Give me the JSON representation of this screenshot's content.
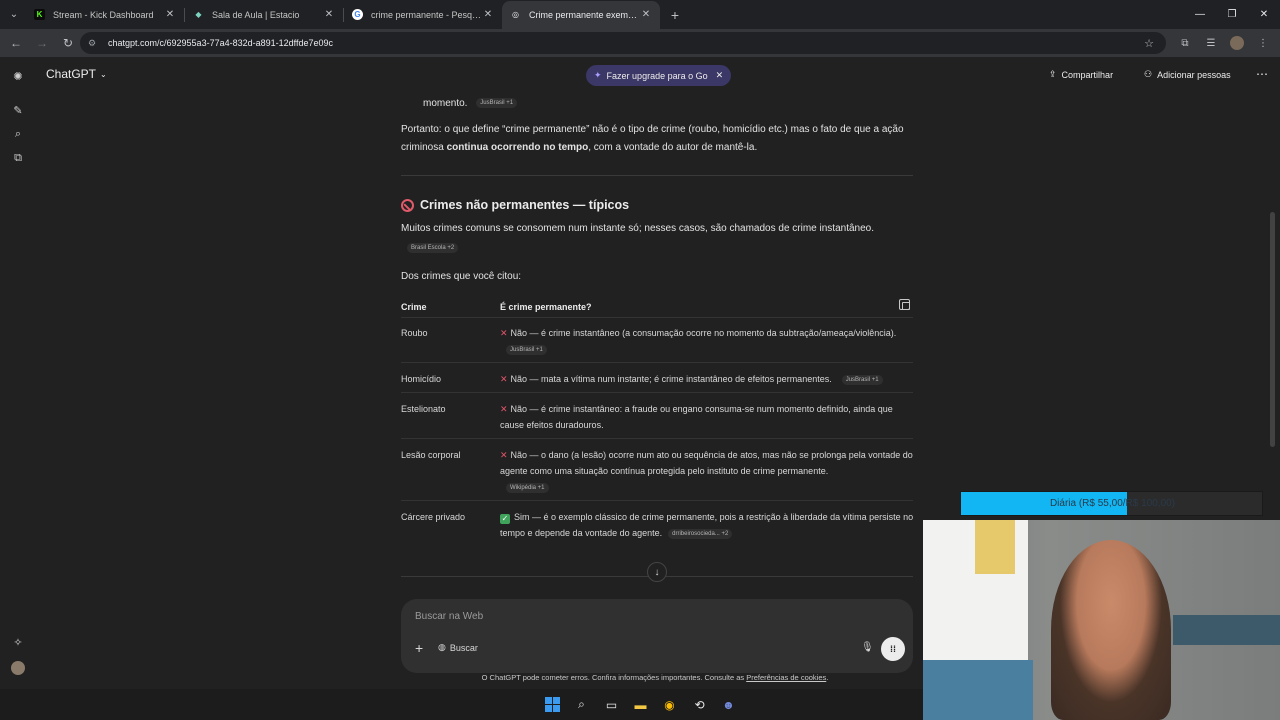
{
  "browser": {
    "tabs": [
      {
        "title": "Stream - Kick Dashboard",
        "favicon_color": "#53fc18",
        "favicon_glyph": "K"
      },
      {
        "title": "Sala de Aula | Estacio",
        "favicon_color": "#7dd3c0",
        "favicon_glyph": "◆"
      },
      {
        "title": "crime permanente - Pesquisa G",
        "favicon_color": "#e8eaed",
        "favicon_glyph": "G"
      },
      {
        "title": "Crime permanente exemplos",
        "favicon_color": "#e8eaed",
        "favicon_glyph": "◎",
        "active": true
      }
    ],
    "url": "chatgpt.com/c/692955a3-77a4-832d-a891-12dffde7e09c"
  },
  "app": {
    "brand": "ChatGPT",
    "upgrade_label": "Fazer upgrade para o Go",
    "share_label": "Compartilhar",
    "add_people_label": "Adicionar pessoas"
  },
  "conversation": {
    "prev_item_text": "momento.",
    "prev_item_chip": "JusBrasil +1",
    "para1_a": "Portanto: o que define “crime permanente” não é o tipo de crime (roubo, homicídio etc.) mas o fato de que a ação criminosa ",
    "para1_bold": "continua ocorrendo no tempo",
    "para1_b": ", com a vontade do autor de mantê-la.",
    "heading": "Crimes não permanentes — típicos",
    "para2": "Muitos crimes comuns se consomem num instante só; nesses casos, são chamados de crime instantâneo.",
    "para2_chip": "Brasil Escola +2",
    "para3": "Dos crimes que você citou:",
    "table": {
      "headers": [
        "Crime",
        "É crime permanente?"
      ],
      "rows": [
        {
          "crime": "Roubo",
          "mark": "✕",
          "answer": "Não — é crime instantâneo (a consumação ocorre no momento da subtração/ameaça/violência).",
          "chip": "JusBrasil +1"
        },
        {
          "crime": "Homicídio",
          "mark": "✕",
          "answer": "Não — mata a vítima num instante; é crime instantâneo de efeitos permanentes.",
          "chip": "JusBrasil +1"
        },
        {
          "crime": "Estelionato",
          "mark": "✕",
          "answer": "Não — é crime instantâneo: a fraude ou engano consuma-se num momento definido, ainda que cause efeitos duradouros.",
          "chip": ""
        },
        {
          "crime": "Lesão corporal",
          "mark": "✕",
          "answer": "Não — o dano (a lesão) ocorre num ato ou sequência de atos, mas não se prolonga pela vontade do agente como uma situação contínua protegida pelo instituto de crime permanente.",
          "chip": "Wikipédia +1"
        },
        {
          "crime": "Cárcere privado",
          "mark": "✓",
          "answer": "Sim — é o exemplo clássico de crime permanente, pois a restrição à liberdade da vítima persiste no tempo e depende da vontade do agente.",
          "chip": "drribeirosocieda... +2"
        }
      ]
    }
  },
  "composer": {
    "placeholder": "Buscar na Web",
    "search_tool_label": "Buscar"
  },
  "disclaimer": {
    "text": "O ChatGPT pode cometer erros. Confira informações importantes. Consulte as ",
    "link": "Preferências de cookies",
    "end": "."
  },
  "overlay": {
    "donation_label": "Diária (R$ 55,00/R$ 100,00)",
    "donation_progress": 0.55,
    "bar_color": "#12b6f2"
  }
}
